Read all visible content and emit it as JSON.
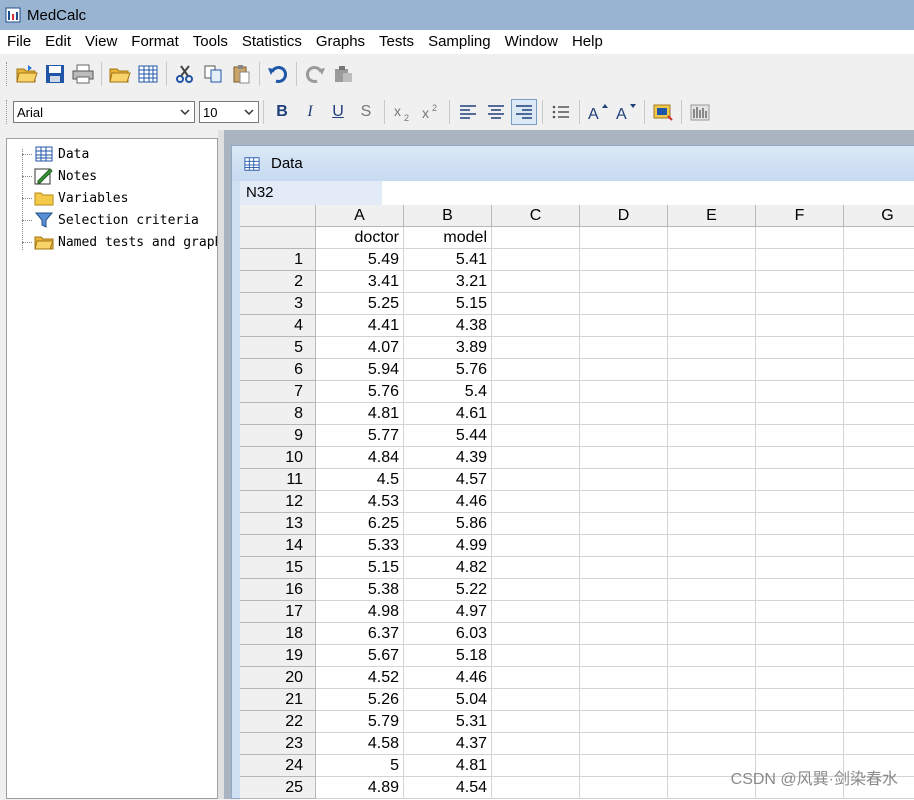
{
  "app": {
    "title": "MedCalc"
  },
  "menu": [
    "File",
    "Edit",
    "View",
    "Format",
    "Tools",
    "Statistics",
    "Graphs",
    "Tests",
    "Sampling",
    "Window",
    "Help"
  ],
  "toolbar": {
    "buttons": [
      "open-folder-icon",
      "save-icon",
      "print-icon",
      "open-data-icon",
      "spreadsheet-icon",
      "cut-icon",
      "copy-icon",
      "paste-icon",
      "undo-icon",
      "redo-icon",
      "paste-special-icon"
    ]
  },
  "format_bar": {
    "font": "Arial",
    "size": "10",
    "bold": "B",
    "italic": "I",
    "underline": "U",
    "strike": "S"
  },
  "tree": {
    "items": [
      {
        "label": "Data",
        "icon": "grid-icon"
      },
      {
        "label": "Notes",
        "icon": "notes-icon"
      },
      {
        "label": "Variables",
        "icon": "folder-icon"
      },
      {
        "label": "Selection criteria",
        "icon": "filter-icon"
      },
      {
        "label": "Named tests and graphs",
        "icon": "folder-icon"
      }
    ]
  },
  "spreadsheet": {
    "window_title": "Data",
    "cell_ref": "N32",
    "columns": [
      "A",
      "B",
      "C",
      "D",
      "E",
      "F",
      "G"
    ],
    "var_names": [
      "doctor",
      "model"
    ],
    "rows": [
      [
        "1",
        "5.49",
        "5.41"
      ],
      [
        "2",
        "3.41",
        "3.21"
      ],
      [
        "3",
        "5.25",
        "5.15"
      ],
      [
        "4",
        "4.41",
        "4.38"
      ],
      [
        "5",
        "4.07",
        "3.89"
      ],
      [
        "6",
        "5.94",
        "5.76"
      ],
      [
        "7",
        "5.76",
        "5.4"
      ],
      [
        "8",
        "4.81",
        "4.61"
      ],
      [
        "9",
        "5.77",
        "5.44"
      ],
      [
        "10",
        "4.84",
        "4.39"
      ],
      [
        "11",
        "4.5",
        "4.57"
      ],
      [
        "12",
        "4.53",
        "4.46"
      ],
      [
        "13",
        "6.25",
        "5.86"
      ],
      [
        "14",
        "5.33",
        "4.99"
      ],
      [
        "15",
        "5.15",
        "4.82"
      ],
      [
        "16",
        "5.38",
        "5.22"
      ],
      [
        "17",
        "4.98",
        "4.97"
      ],
      [
        "18",
        "6.37",
        "6.03"
      ],
      [
        "19",
        "5.67",
        "5.18"
      ],
      [
        "20",
        "4.52",
        "4.46"
      ],
      [
        "21",
        "5.26",
        "5.04"
      ],
      [
        "22",
        "5.79",
        "5.31"
      ],
      [
        "23",
        "4.58",
        "4.37"
      ],
      [
        "24",
        "5",
        "4.81"
      ],
      [
        "25",
        "4.89",
        "4.54"
      ]
    ]
  },
  "watermark": "CSDN @风巽·剑染春水"
}
